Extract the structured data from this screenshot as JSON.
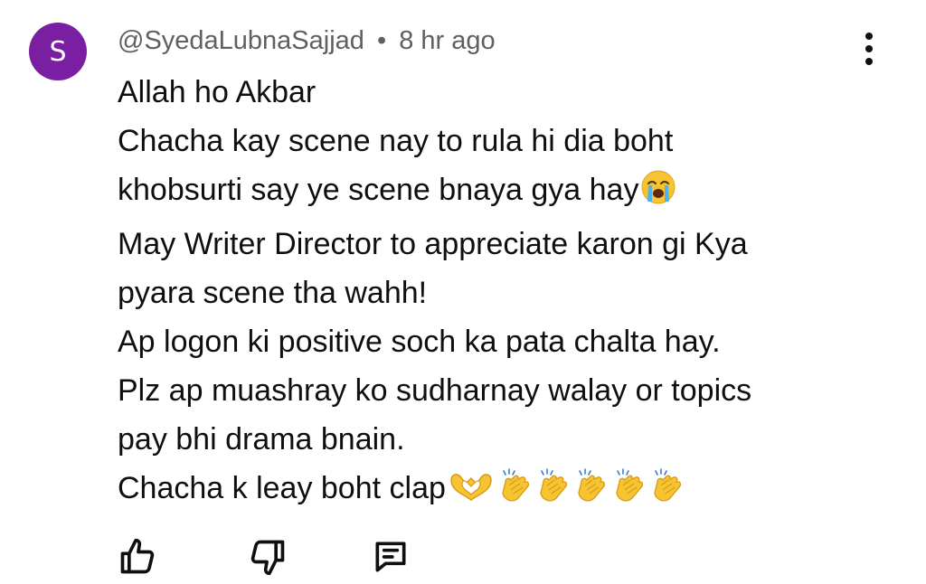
{
  "comment": {
    "avatar_letter": "S",
    "avatar_color": "#7b1fa2",
    "author": "@SyedaLubnaSajjad",
    "separator": "•",
    "time": "8 hr ago",
    "lines": [
      "Allah ho Akbar",
      "Chacha kay scene nay to rula hi dia boht",
      "khobsurti say ye scene bnaya gya hay",
      "May Writer Director to appreciate karon gi Kya",
      "pyara scene tha wahh!",
      "Ap logon ki positive soch ka pata chalta hay.",
      "Plz ap muashray ko sudharnay walay or topics",
      "pay bhi drama bnain.",
      "Chacha k leay boht clap"
    ],
    "icons": {
      "menu": "more-vert-icon",
      "like": "thumbs-up-icon",
      "dislike": "thumbs-down-icon",
      "reply": "reply-comment-icon",
      "crying_emoji": "loudly-crying-face-emoji",
      "heart_hands_emoji": "heart-hands-emoji",
      "clap_emoji": "clapping-hands-emoji"
    }
  }
}
